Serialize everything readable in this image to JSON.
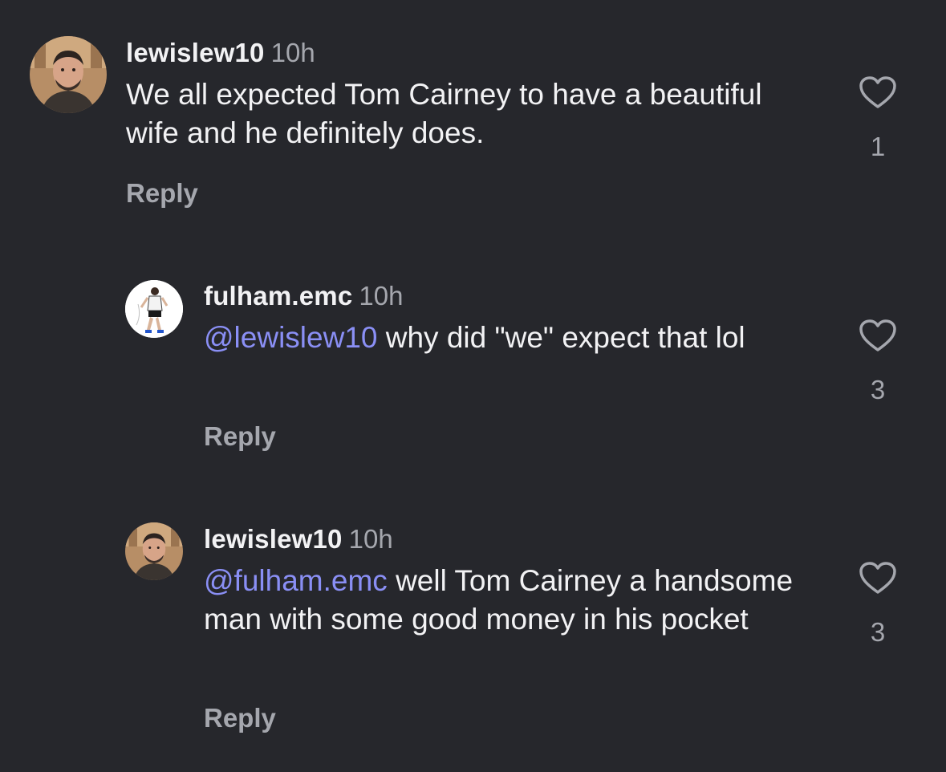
{
  "comments": [
    {
      "username": "lewislew10",
      "time": "10h",
      "mention": "",
      "text": "We all expected Tom Cairney to have a beautiful wife and he definitely does.",
      "reply_label": "Reply",
      "like_count": "1",
      "avatar": "man-photo-avatar"
    },
    {
      "username": "fulham.emc",
      "time": "10h",
      "mention": "@lewislew10",
      "text": " why did \"we\" expect that lol",
      "reply_label": "Reply",
      "like_count": "3",
      "avatar": "footballer-illustration-avatar"
    },
    {
      "username": "lewislew10",
      "time": "10h",
      "mention": "@fulham.emc",
      "text": " well Tom Cairney a handsome man with some good money in his pocket",
      "reply_label": "Reply",
      "like_count": "3",
      "avatar": "man-photo-avatar"
    }
  ],
  "colors": {
    "background": "#26272c",
    "text": "#f2f2f4",
    "secondary": "#a5a7ae",
    "mention": "#8a8ff5"
  },
  "icons": {
    "like": "heart-outline-icon"
  }
}
